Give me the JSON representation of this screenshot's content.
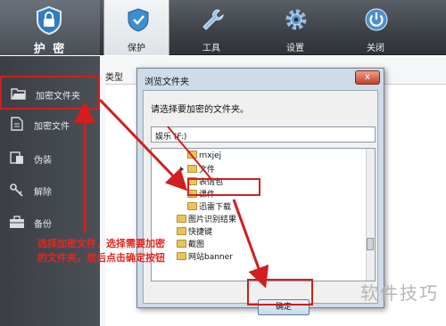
{
  "app": {
    "logo_label": "护 密"
  },
  "nav": [
    {
      "label": "保护",
      "icon": "shield-icon",
      "active": true
    },
    {
      "label": "工具",
      "icon": "wrench-icon",
      "active": false
    },
    {
      "label": "设置",
      "icon": "gear-icon",
      "active": false
    },
    {
      "label": "关闭",
      "icon": "power-icon",
      "active": false
    }
  ],
  "sidebar": {
    "items": [
      {
        "label": "加密文件夹",
        "icon": "open-folder-icon",
        "selected": true
      },
      {
        "label": "加密文件",
        "icon": "file-icon",
        "selected": false
      },
      {
        "label": "伪装",
        "icon": "disguise-icon",
        "selected": false
      },
      {
        "label": "解除",
        "icon": "unlock-icon",
        "selected": false
      },
      {
        "label": "备份",
        "icon": "toolbox-icon",
        "selected": false
      }
    ]
  },
  "main": {
    "column_type": "类型"
  },
  "dialog": {
    "title": "浏览文件夹",
    "close_label": "x",
    "prompt": "请选择要加密的文件夹。",
    "path_value": "娱乐 (F:)",
    "tree": [
      {
        "label": "rnxjej",
        "indent": 2,
        "expander": false
      },
      {
        "label": "文件",
        "indent": 2,
        "expander": true
      },
      {
        "label": "表情包",
        "indent": 2,
        "expander": false
      },
      {
        "label": "课件",
        "indent": 2,
        "expander": false
      },
      {
        "label": "迅雷下载",
        "indent": 2,
        "expander": false
      },
      {
        "label": "图片识别结果",
        "indent": 1,
        "expander": false
      },
      {
        "label": "快捷键",
        "indent": 1,
        "expander": false
      },
      {
        "label": "截图",
        "indent": 1,
        "expander": false
      },
      {
        "label": "网站banner",
        "indent": 1,
        "expander": false
      }
    ],
    "ok_label": "确定"
  },
  "annotation": {
    "text": "选择加密文件，选择需要加密的文件夹，然后点击确定按钮"
  },
  "watermark": {
    "text": "软件技巧"
  },
  "colors": {
    "highlight": "#d21e1e",
    "topbar": "#3e4349",
    "dialog": "#cfdbe8"
  }
}
